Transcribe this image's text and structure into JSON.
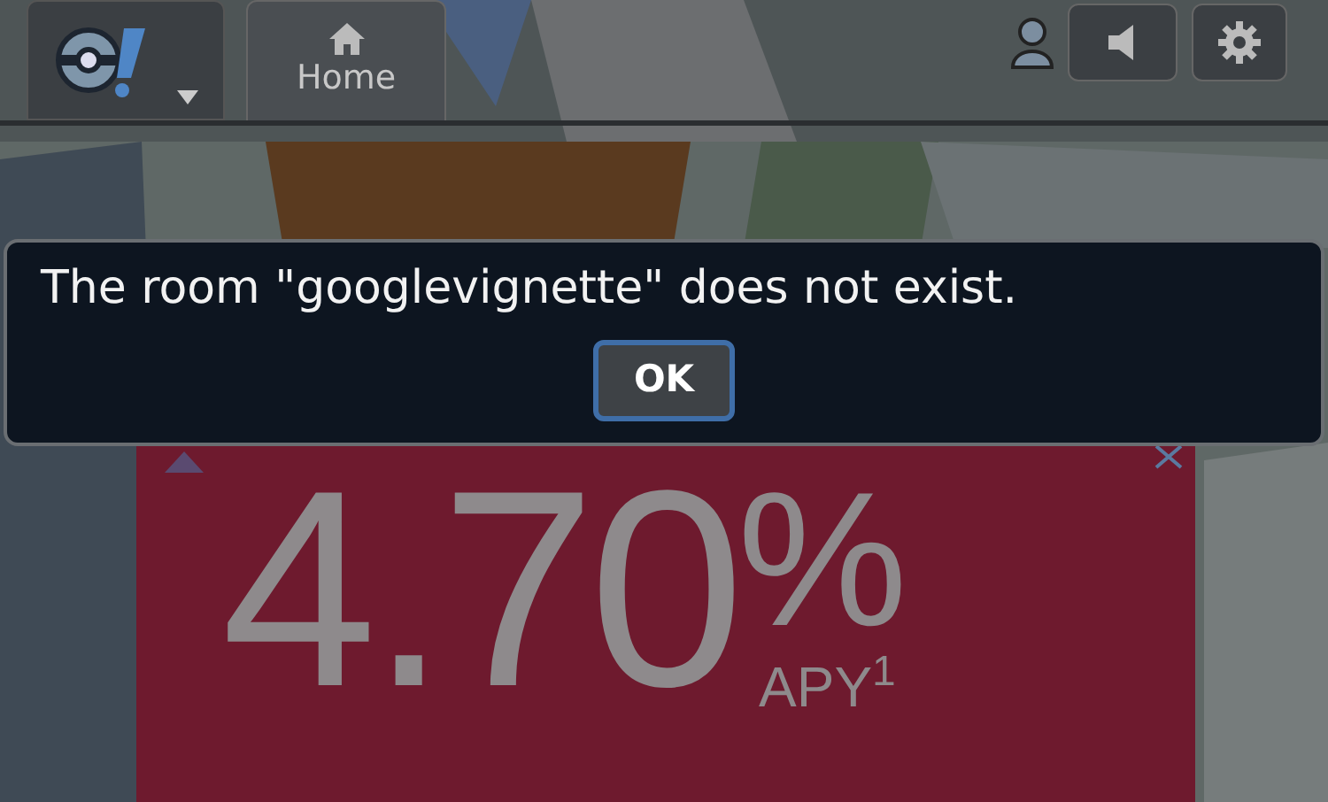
{
  "top_bar": {
    "tabs": [
      {
        "kind": "home",
        "label": "Home",
        "selected": true
      }
    ]
  },
  "dialog": {
    "message": "The room \"googlevignette\" does not exist.",
    "button": "OK"
  },
  "ad": {
    "rate": "4.70",
    "percent": "%",
    "label": "APY$^{1}$"
  }
}
